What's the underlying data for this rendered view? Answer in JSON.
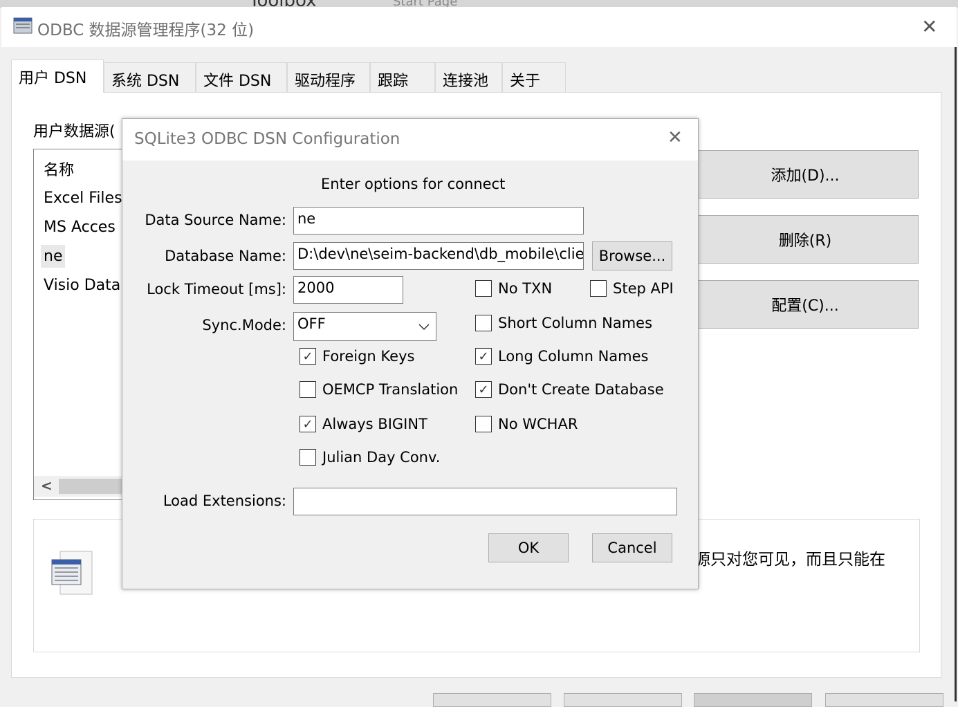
{
  "background": {
    "toolbox": "Toolbox",
    "start_page": "Start Page"
  },
  "window": {
    "title": "ODBC 数据源管理程序(32 位)",
    "close": "✕"
  },
  "tabs": [
    "用户 DSN",
    "系统 DSN",
    "文件 DSN",
    "驱动程序",
    "跟踪",
    "连接池",
    "关于"
  ],
  "panel": {
    "list_label": "用户数据源(",
    "list_header": "名称",
    "items": [
      "Excel Files",
      "MS Acces",
      "ne",
      "Visio Data"
    ],
    "selected_item": "ne",
    "scroll_left": "<",
    "buttons": {
      "add": "添加(D)...",
      "remove": "删除(R)",
      "configure": "配置(C)..."
    },
    "description": "源只对您可见，而且只能在"
  },
  "dialog": {
    "title": "SQLite3 ODBC DSN Configuration",
    "close": "✕",
    "heading": "Enter options for connect",
    "dsn_label": "Data Source Name:",
    "dsn_value": "ne",
    "db_label": "Database Name:",
    "db_value": "D:\\dev\\ne\\seim-backend\\db_mobile\\client",
    "browse": "Browse...",
    "timeout_label": "Lock Timeout [ms]:",
    "timeout_value": "2000",
    "sync_label": "Sync.Mode:",
    "sync_value": "OFF",
    "checkboxes": [
      {
        "label": "No TXN",
        "checked": false
      },
      {
        "label": "Step API",
        "checked": false
      },
      {
        "label": "Short Column Names",
        "checked": false
      },
      {
        "label": "Foreign Keys",
        "checked": true
      },
      {
        "label": "Long Column Names",
        "checked": true
      },
      {
        "label": "OEMCP Translation",
        "checked": false
      },
      {
        "label": "Don't Create Database",
        "checked": true
      },
      {
        "label": "Always BIGINT",
        "checked": true
      },
      {
        "label": "No WCHAR",
        "checked": false
      },
      {
        "label": "Julian Day Conv.",
        "checked": false
      }
    ],
    "ext_label": "Load Extensions:",
    "ext_value": "",
    "ok": "OK",
    "cancel": "Cancel"
  }
}
